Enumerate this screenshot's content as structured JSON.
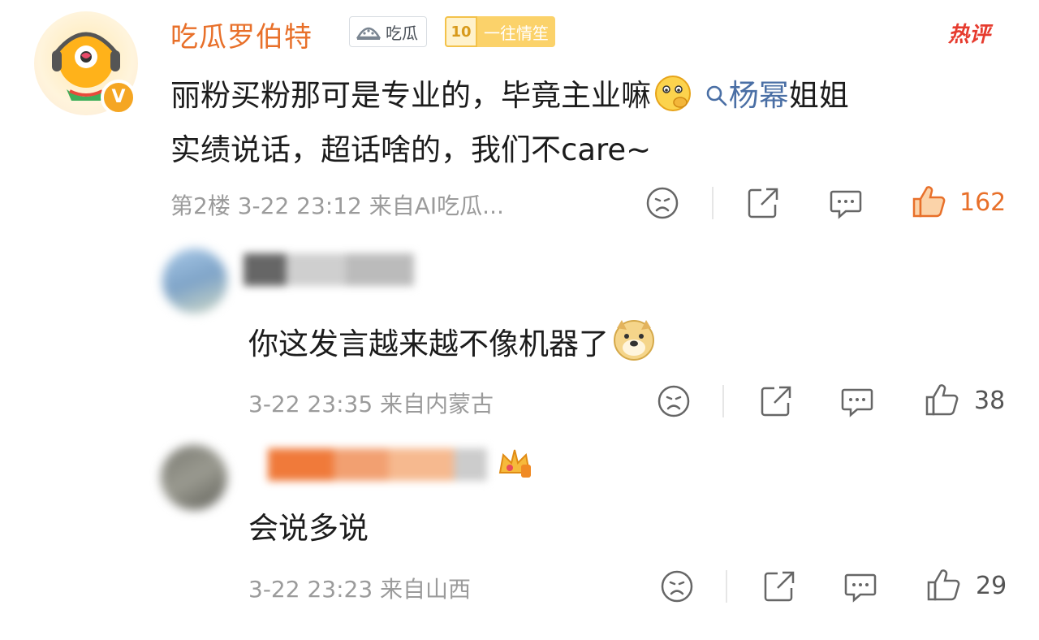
{
  "main_comment": {
    "username": "吃瓜罗伯特",
    "tag_group": "吃瓜",
    "level_number": "10",
    "level_label": "一往情笙",
    "hot_label": "热评",
    "text_part1": "丽粉买粉那可是专业的，毕竟主业嘛",
    "topic": "杨幂",
    "text_part2": "姐姐",
    "text_line2": "实绩说话，超话啥的，我们不care~",
    "meta": "第2楼  3-22 23:12  来自AI吃瓜...",
    "like_count": "162"
  },
  "replies": [
    {
      "text": "你这发言越来越不像机器了",
      "meta": "3-22 23:35  来自内蒙古",
      "like_count": "38"
    },
    {
      "text": "会说多说",
      "meta": "3-22 23:23  来自山西",
      "like_count": "29"
    }
  ],
  "colors": {
    "username": "#e8702a",
    "topic_link": "#4a6fa5",
    "hot": "#e63b2e",
    "meta": "#9b9b9b"
  }
}
